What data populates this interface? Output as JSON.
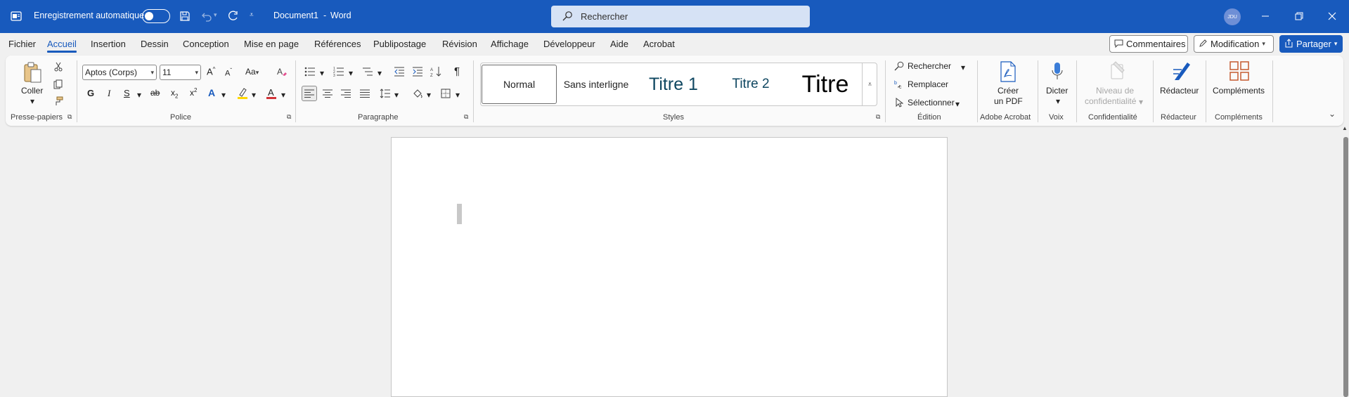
{
  "titlebar": {
    "autosave_label": "Enregistrement automatique",
    "doc_title": "Document1",
    "separator": "-",
    "app_name": "Word",
    "search_placeholder": "Rechercher",
    "avatar_initials": "JDU"
  },
  "menu": {
    "items": [
      "Fichier",
      "Accueil",
      "Insertion",
      "Dessin",
      "Conception",
      "Mise en page",
      "Références",
      "Publipostage",
      "Révision",
      "Affichage",
      "Développeur",
      "Aide",
      "Acrobat"
    ],
    "active": "Accueil",
    "comments_label": "Commentaires",
    "mode_label": "Modification",
    "share_label": "Partager"
  },
  "ribbon": {
    "clipboard": {
      "paste_label": "Coller",
      "group_label": "Presse-papiers"
    },
    "font": {
      "font_name": "Aptos (Corps)",
      "font_size": "11",
      "bold_glyph": "G",
      "italic_glyph": "I",
      "underline_glyph": "S",
      "group_label": "Police"
    },
    "paragraph": {
      "group_label": "Paragraphe"
    },
    "styles": {
      "items": [
        "Normal",
        "Sans interligne",
        "Titre 1",
        "Titre 2",
        "Titre"
      ],
      "group_label": "Styles"
    },
    "editing": {
      "find_label": "Rechercher",
      "replace_label": "Remplacer",
      "select_label": "Sélectionner",
      "group_label": "Édition"
    },
    "acrobat": {
      "create_pdf_line1": "Créer",
      "create_pdf_line2": "un PDF",
      "group_label": "Adobe Acrobat"
    },
    "voice": {
      "dictate_label": "Dicter",
      "group_label": "Voix"
    },
    "sensitivity": {
      "line1": "Niveau de",
      "line2": "confidentialité",
      "group_label": "Confidentialité"
    },
    "editor": {
      "label": "Rédacteur",
      "group_label": "Rédacteur"
    },
    "addins": {
      "label": "Compléments",
      "group_label": "Compléments"
    }
  },
  "colors": {
    "brand": "#185abd",
    "highlight": "#ffd700",
    "font_color": "#d13438"
  }
}
